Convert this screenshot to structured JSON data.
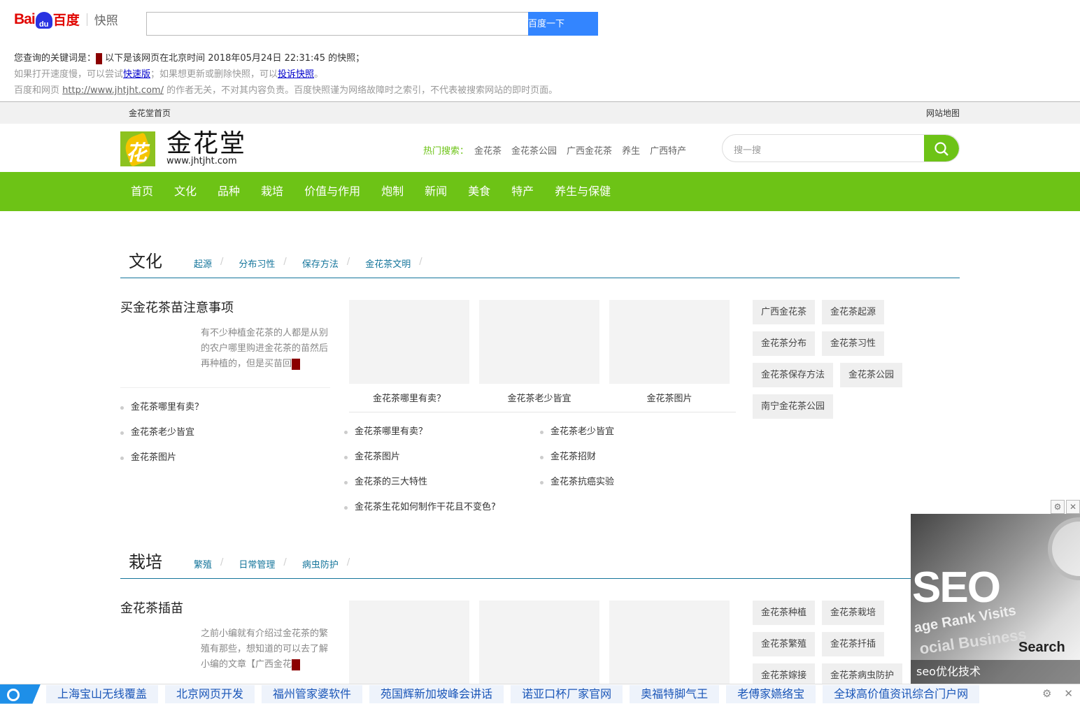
{
  "snapshot": {
    "logo_bai": "Bai",
    "logo_du": "du",
    "logo_baidu": "百度",
    "logo_kuaizhao": "快照",
    "search_value": "",
    "button": "百度一下",
    "line1_prefix": "您查询的关键词是：",
    "line1_suffix": " 以下是该网页在北京时间 2018年05月24日 22:31:45 的快照；",
    "line2_a": "如果打开速度慢，可以尝试",
    "line2_link1": "快速版",
    "line2_b": "；如果想更新或删除快照，可以",
    "line2_link2": "投诉快照",
    "line2_c": "。",
    "line3_a": "百度和网页 ",
    "line3_url": "http://www.jhtjht.com/",
    "line3_b": " 的作者无关，不对其内容负责。百度快照谨为网络故障时之索引，不代表被搜索网站的即时页面。"
  },
  "site": {
    "topbar_home": "金花堂首页",
    "topbar_map": "网站地图",
    "logo_glyph": "花",
    "logo_cn": "金花堂",
    "logo_en": "www.jhtjht.com",
    "hot_label": "热门搜索：",
    "hot": [
      "金花茶",
      "金花茶公园",
      "广西金花茶",
      "养生",
      "广西特产"
    ],
    "search_placeholder": "搜一搜",
    "nav": [
      "首页",
      "文化",
      "品种",
      "栽培",
      "价值与作用",
      "炮制",
      "新闻",
      "美食",
      "特产",
      "养生与保健"
    ]
  },
  "culture": {
    "title": "文化",
    "tabs": [
      "起源",
      "分布习性",
      "保存方法",
      "金花茶文明"
    ],
    "lead": "买金花茶苗注意事项",
    "desc": "有不少种植金花茶的人都是从别的农户哪里购进金花茶的苗然后再种植的，但是买苗回",
    "left_list": [
      "金花茶哪里有卖？",
      "金花茶老少皆宜",
      "金花茶图片"
    ],
    "thumbs": [
      "金花茶哪里有卖？",
      "金花茶老少皆宜",
      "金花茶图片"
    ],
    "mid_col1": [
      "金花茶哪里有卖？",
      "金花茶图片",
      "金花茶的三大特性",
      "金花茶生花如何制作干花且不变色?"
    ],
    "mid_col2": [
      "金花茶老少皆宜",
      "金花茶招财",
      "金花茶抗癌实验"
    ],
    "tags": [
      "广西金花茶",
      "金花茶起源",
      "金花茶分布",
      "金花茶习性",
      "金花茶保存方法",
      "金花茶公园",
      "南宁金花茶公园"
    ]
  },
  "cultivation": {
    "title": "栽培",
    "tabs": [
      "繁殖",
      "日常管理",
      "病虫防护"
    ],
    "lead": "金花茶插苗",
    "desc": "之前小编就有介绍过金花茶的繁殖有那些，想知道的可以去了解小编的文章【广西金花",
    "tags": [
      "金花茶种植",
      "金花茶栽培",
      "金花茶繁殖",
      "金花茶扦插",
      "金花茶嫁接",
      "金花茶病虫防护"
    ]
  },
  "ad": {
    "word_main": "SEO",
    "word_a": "age Rank Visits",
    "word_b": "ocial Business",
    "word_c": "Search",
    "caption": "seo优化技术",
    "close": "✕",
    "settings": "⚙"
  },
  "bottom_links": [
    "上海宝山无线覆盖",
    "北京网页开发",
    "福州管家婆软件",
    "苑国辉新加坡峰会讲话",
    "诺亚口杯厂家官网",
    "奥福特脚气王",
    "老傅家嬿络宝",
    "全球高价值资讯综合门户网"
  ]
}
